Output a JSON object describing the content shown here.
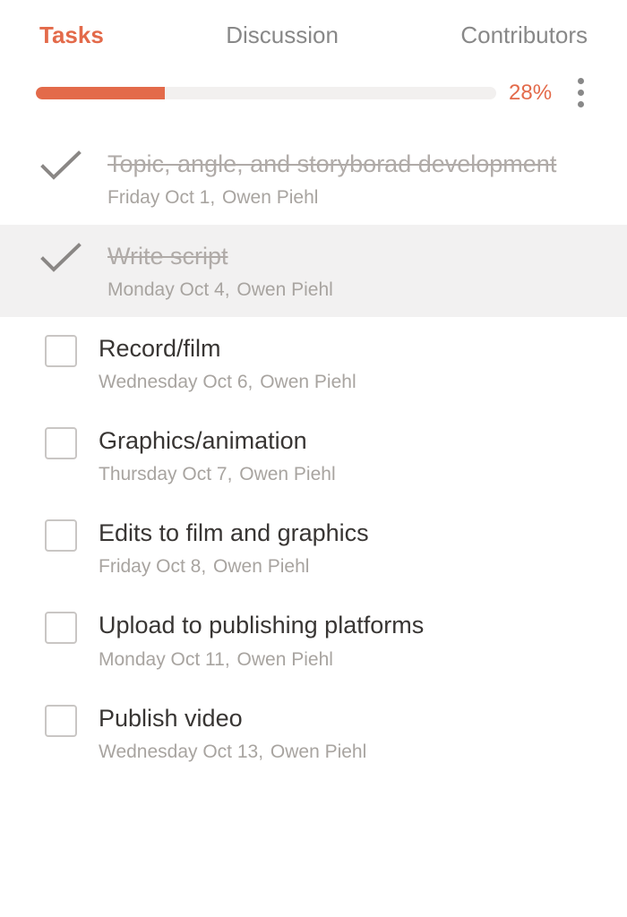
{
  "tabs": {
    "tasks": "Tasks",
    "discussion": "Discussion",
    "contributors": "Contributors",
    "active": "tasks"
  },
  "progress": {
    "percent_label": "28%",
    "percent_value": 28
  },
  "tasks": [
    {
      "title": "Topic, angle, and storyborad development",
      "date": "Friday Oct 1",
      "assignee": "Owen Piehl",
      "completed": true,
      "selected": false
    },
    {
      "title": "Write script",
      "date": "Monday Oct 4",
      "assignee": "Owen Piehl",
      "completed": true,
      "selected": true
    },
    {
      "title": "Record/film",
      "date": "Wednesday Oct 6",
      "assignee": "Owen Piehl",
      "completed": false,
      "selected": false
    },
    {
      "title": "Graphics/animation",
      "date": "Thursday Oct 7",
      "assignee": "Owen Piehl",
      "completed": false,
      "selected": false
    },
    {
      "title": "Edits to film and graphics",
      "date": "Friday Oct 8",
      "assignee": "Owen Piehl",
      "completed": false,
      "selected": false
    },
    {
      "title": "Upload to publishing platforms",
      "date": "Monday Oct 11",
      "assignee": "Owen Piehl",
      "completed": false,
      "selected": false
    },
    {
      "title": "Publish video",
      "date": "Wednesday Oct 13",
      "assignee": "Owen Piehl",
      "completed": false,
      "selected": false
    }
  ]
}
